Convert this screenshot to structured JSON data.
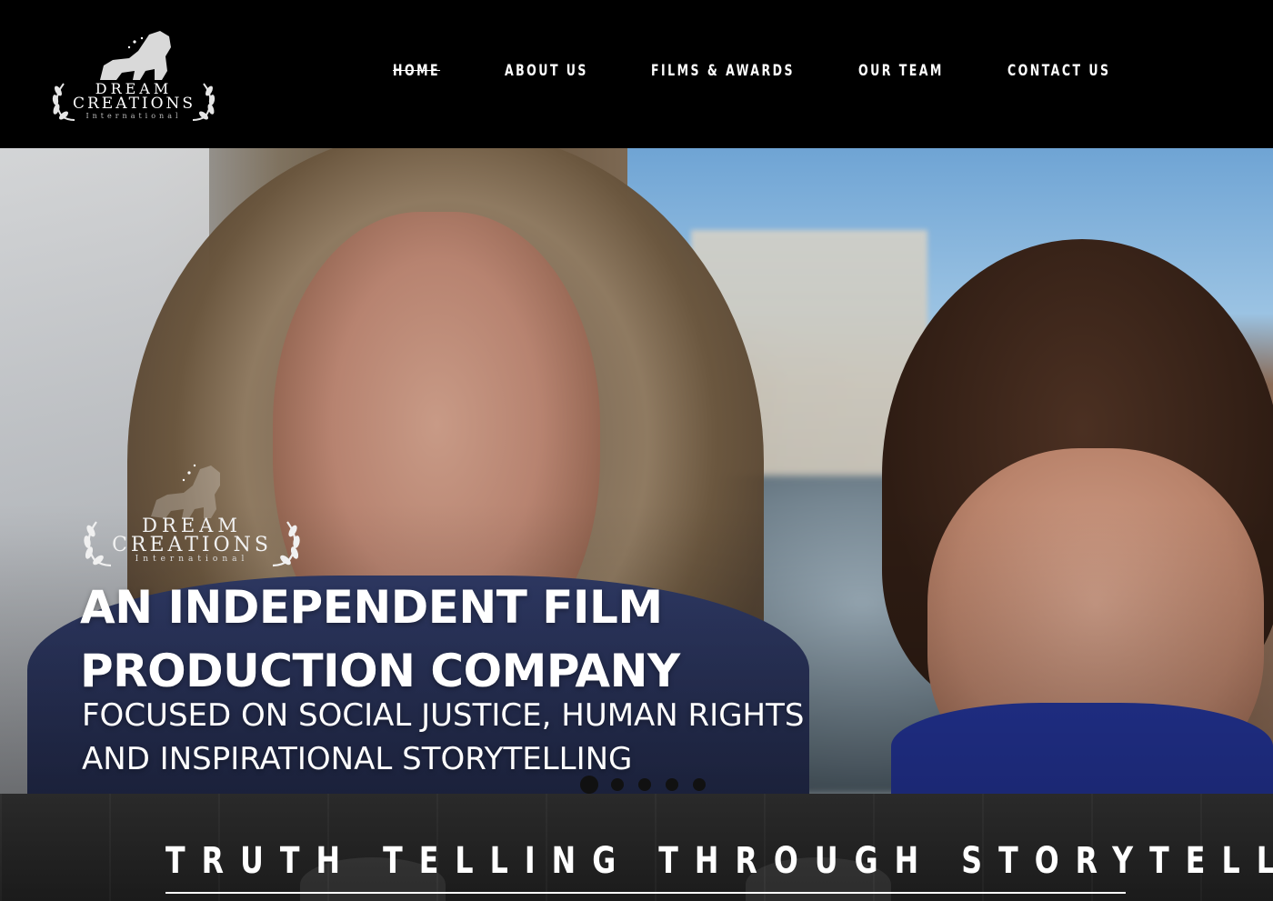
{
  "brand": {
    "line1": "DREAM",
    "line2": "CREATIONS",
    "line3": "International"
  },
  "nav": {
    "items": [
      {
        "label": "HOME",
        "active": true
      },
      {
        "label": "ABOUT US",
        "active": false
      },
      {
        "label": "FILMS & AWARDS",
        "active": false
      },
      {
        "label": "OUR TEAM",
        "active": false
      },
      {
        "label": "CONTACT US",
        "active": false
      }
    ]
  },
  "hero": {
    "logo": {
      "line1": "DREAM",
      "line2": "CREATIONS",
      "line3": "International"
    },
    "headline_line1": "AN INDEPENDENT FILM",
    "headline_line2": "PRODUCTION COMPANY",
    "subline_line1": "FOCUSED ON SOCIAL JUSTICE, HUMAN RIGHTS",
    "subline_line2": "AND INSPIRATIONAL STORYTELLING",
    "slides": {
      "count": 5,
      "active_index": 0
    }
  },
  "band": {
    "tagline": "TRUTH TELLING THROUGH STORYTELLING"
  },
  "colors": {
    "header_bg": "#000000",
    "text": "#ffffff",
    "band_bg": "#222222"
  }
}
